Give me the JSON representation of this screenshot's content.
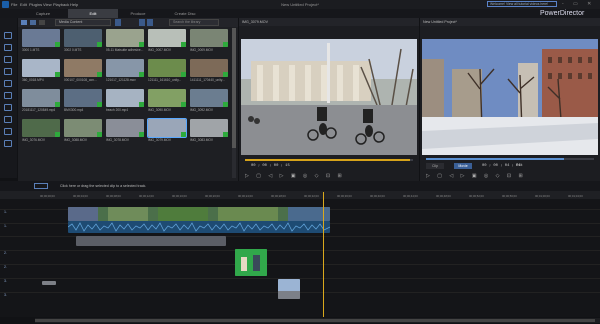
{
  "menubar": {
    "items": [
      "File",
      "Edit",
      "Plugins",
      "View",
      "Playback",
      "Help"
    ],
    "title": "New Untitled Project*",
    "welcome": "Welcome! View all tutorial videos here!",
    "window_controls": "- ▭ ✕"
  },
  "modes": {
    "capture": "Capture",
    "edit": "Edit",
    "produce": "Produce",
    "create_disc": "Create Disc"
  },
  "brand": "PowerDirector",
  "library": {
    "dropdown": "Media Content",
    "search_placeholder": "Search the library",
    "thumbs": [
      {
        "label": "3000 1.MTS",
        "color": "#6a7a95"
      },
      {
        "label": "3002 0.MTS",
        "color": "#4d5f70"
      },
      {
        "label": "05-11 Matsutte adhesive...",
        "color": "#9aa38e"
      },
      {
        "label": "IMG_0007.MOV",
        "color": "#b8bfb8"
      },
      {
        "label": "IMG_0009.MOV",
        "color": "#7a8574"
      },
      {
        "label": "360_0018.MP4",
        "color": "#a9b6c8"
      },
      {
        "label": "000107_000108_con...",
        "color": "#8f7a65"
      },
      {
        "label": "121017_121128.mov",
        "color": "#8796a8"
      },
      {
        "label": "121111_161610_unity...",
        "color": "#6c8c4c"
      },
      {
        "label": "1411111_170440_unity...",
        "color": "#7d6a58"
      },
      {
        "label": "20181117_120849.mp4",
        "color": "#7f8d9c"
      },
      {
        "label": "BMX300.mp4",
        "color": "#5c6e84"
      },
      {
        "label": "beach 200.mp4",
        "color": "#a6b3c2"
      },
      {
        "label": "IMG_3090.MOV",
        "color": "#82a064"
      },
      {
        "label": "IMG_3092.MOV",
        "color": "#6b7d90"
      },
      {
        "label": "IMG_3076.MOV",
        "color": "#4f6a4a"
      },
      {
        "label": "IMG_3088.MOV",
        "color": "#7c8c74"
      },
      {
        "label": "IMG_3078.MOV",
        "color": "#8a8e98"
      },
      {
        "label": "IMG_3079.MOV",
        "color": "#9aa6b8"
      },
      {
        "label": "IMG_3083.MOV",
        "color": "#a0a4a8"
      }
    ]
  },
  "preview_left": {
    "title": "IMG_3079.MOV",
    "timecode": "00 ; 00 ; 00 ; 15",
    "progress": 0.98
  },
  "preview_right": {
    "title": "New Untitled Project*",
    "clip_tab": "Clip",
    "movie_tab": "Movie",
    "timecode": "00 ; 00 ; 04 ; 06",
    "zoom": "Fit",
    "progress": 0.82
  },
  "timeline": {
    "hint": "Click here or drag the selected clip to a selected track.",
    "ruler": [
      "00;00;00;00",
      "00;00;04;00",
      "00;00;08;00",
      "00;00;12;00",
      "00;00;16;00",
      "00;00;20;00",
      "00;00;24;00",
      "00;00;28;00",
      "00;00;32;00",
      "00;00;36;00",
      "00;00;40;00",
      "00;00;44;00",
      "00;00;48;00",
      "00;00;52;00",
      "00;00;56;00",
      "00;01;00;00",
      "00;01;04;00"
    ],
    "track_labels": [
      "1.",
      "1.",
      "2.",
      "2.",
      "3.",
      "3."
    ]
  },
  "colors": {
    "accent": "#d9a81c",
    "select": "#59a8ff",
    "clip_video": "#2f6e9e",
    "clip_audio": "#1e4b73"
  }
}
